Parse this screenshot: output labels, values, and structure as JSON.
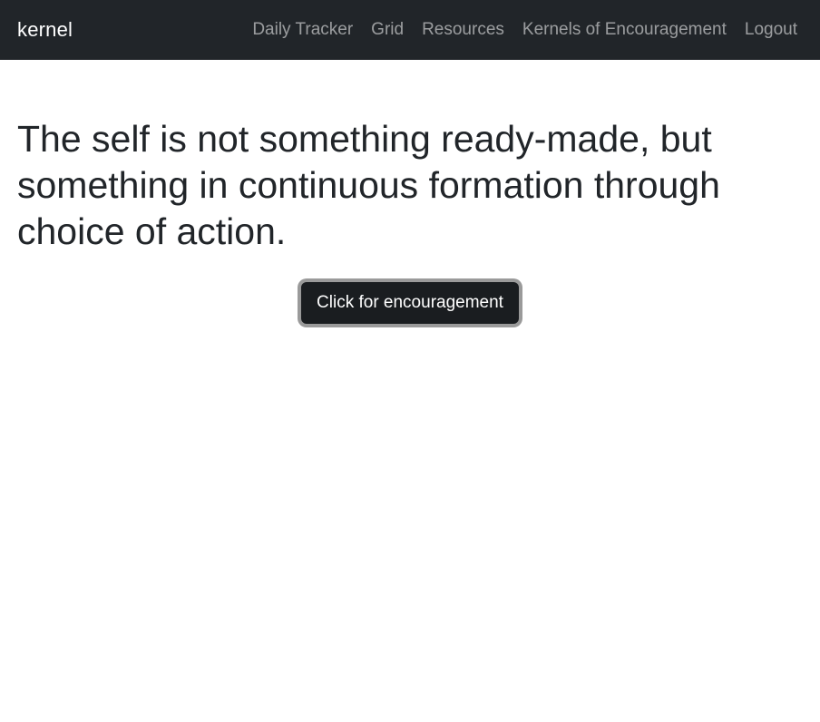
{
  "navbar": {
    "brand": "kernel",
    "links": [
      {
        "label": "Daily Tracker"
      },
      {
        "label": "Grid"
      },
      {
        "label": "Resources"
      },
      {
        "label": "Kernels of Encouragement"
      },
      {
        "label": "Logout"
      }
    ]
  },
  "main": {
    "quote": "The self is not something ready-made, but something in continuous formation through choice of action.",
    "button_label": "Click for encouragement"
  },
  "colors": {
    "navbar_bg": "#212529",
    "button_bg": "#1a1d20",
    "focus_ring": "#9a9a9a"
  }
}
